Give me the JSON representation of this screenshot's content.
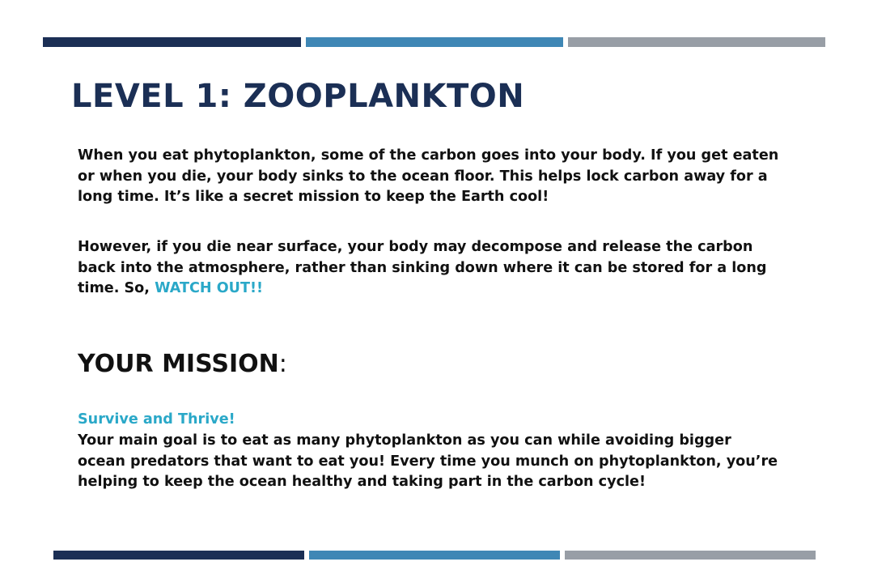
{
  "colors": {
    "navy": "#1b2f55",
    "blue": "#3f87b5",
    "gray": "#989ea6",
    "accent": "#2aa8c8",
    "text": "#111111"
  },
  "slide": {
    "title": "LEVEL 1: ZOOPLANKTON",
    "paragraph1": "When you eat phytoplankton, some of the carbon goes into your body. If you get eaten or when you die, your body sinks to the ocean floor. This helps lock carbon away for a long time. It’s like a secret mission to keep the Earth cool!",
    "paragraph2_main": "However, if you die near surface, your body may decompose and release the carbon back into the atmosphere, rather than sinking down where it can be stored for a long time. So, ",
    "paragraph2_highlight": "WATCH OUT!!",
    "mission_heading": "YOUR MISSION",
    "mission_colon": ":",
    "mission_subtitle": "Survive and Thrive!",
    "mission_text": "Your main goal is to eat as many phytoplankton as you can while avoiding bigger ocean predators that want to eat you! Every time you munch on phytoplankton, you’re helping to keep the ocean healthy and taking part in the carbon cycle!"
  }
}
